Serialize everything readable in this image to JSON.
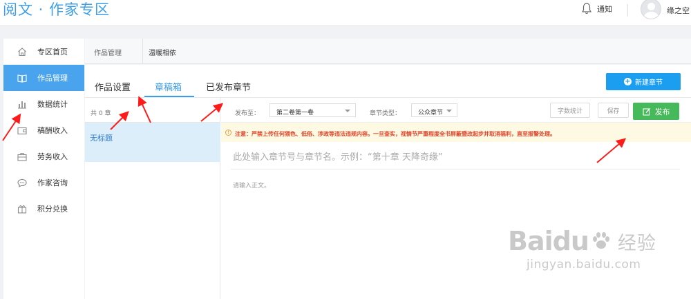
{
  "header": {
    "logo": "阅文 · 作家专区",
    "notice_label": "通知",
    "username": "缘之空"
  },
  "sidebar": {
    "items": [
      {
        "label": "专区首页",
        "icon": "home-icon"
      },
      {
        "label": "作品管理",
        "icon": "book-icon",
        "active": true
      },
      {
        "label": "数据统计",
        "icon": "bar-chart-icon"
      },
      {
        "label": "稿酬收入",
        "icon": "wallet-icon"
      },
      {
        "label": "劳务收入",
        "icon": "briefcase-icon"
      },
      {
        "label": "作家咨询",
        "icon": "chat-icon"
      },
      {
        "label": "积分兑换",
        "icon": "gift-icon"
      }
    ]
  },
  "breadcrumb": {
    "section": "作品管理",
    "book": "温暖相依"
  },
  "tabs": [
    {
      "label": "作品设置"
    },
    {
      "label": "章稿箱",
      "active": true
    },
    {
      "label": "已发布章节"
    }
  ],
  "new_chapter_button": "新建章节",
  "chapter_list": {
    "count_text": "共 0 章",
    "items": [
      "无标题"
    ]
  },
  "toolbar": {
    "publish_to_label": "发布至：",
    "publish_to_value": "第二卷第一卷",
    "chapter_type_label": "章节类型：",
    "chapter_type_value": "公众章节",
    "word_count_button": "字数统计",
    "save_button": "保存",
    "publish_button": "发布"
  },
  "warning": {
    "prefix": "注意：",
    "text": "严禁上传任何猥色、低俗、涉政等违法违规内容。一旦查实，视情节严重程度全书屏蔽暨改起步并取消福利，直至报警处理。"
  },
  "editor": {
    "title_placeholder": "此处输入章节号与章节名。示例：“第十章 天降奇缘”",
    "body_placeholder": "请输入正文。"
  },
  "watermark": {
    "brand": "Baidu",
    "brand_cn": "经验",
    "url": "jingyan.baidu.com"
  },
  "colors": {
    "accent": "#3d9ee8",
    "publish_green": "#46b95a",
    "warning_red": "#e0452a",
    "annotation_red": "#ff1a1a"
  }
}
